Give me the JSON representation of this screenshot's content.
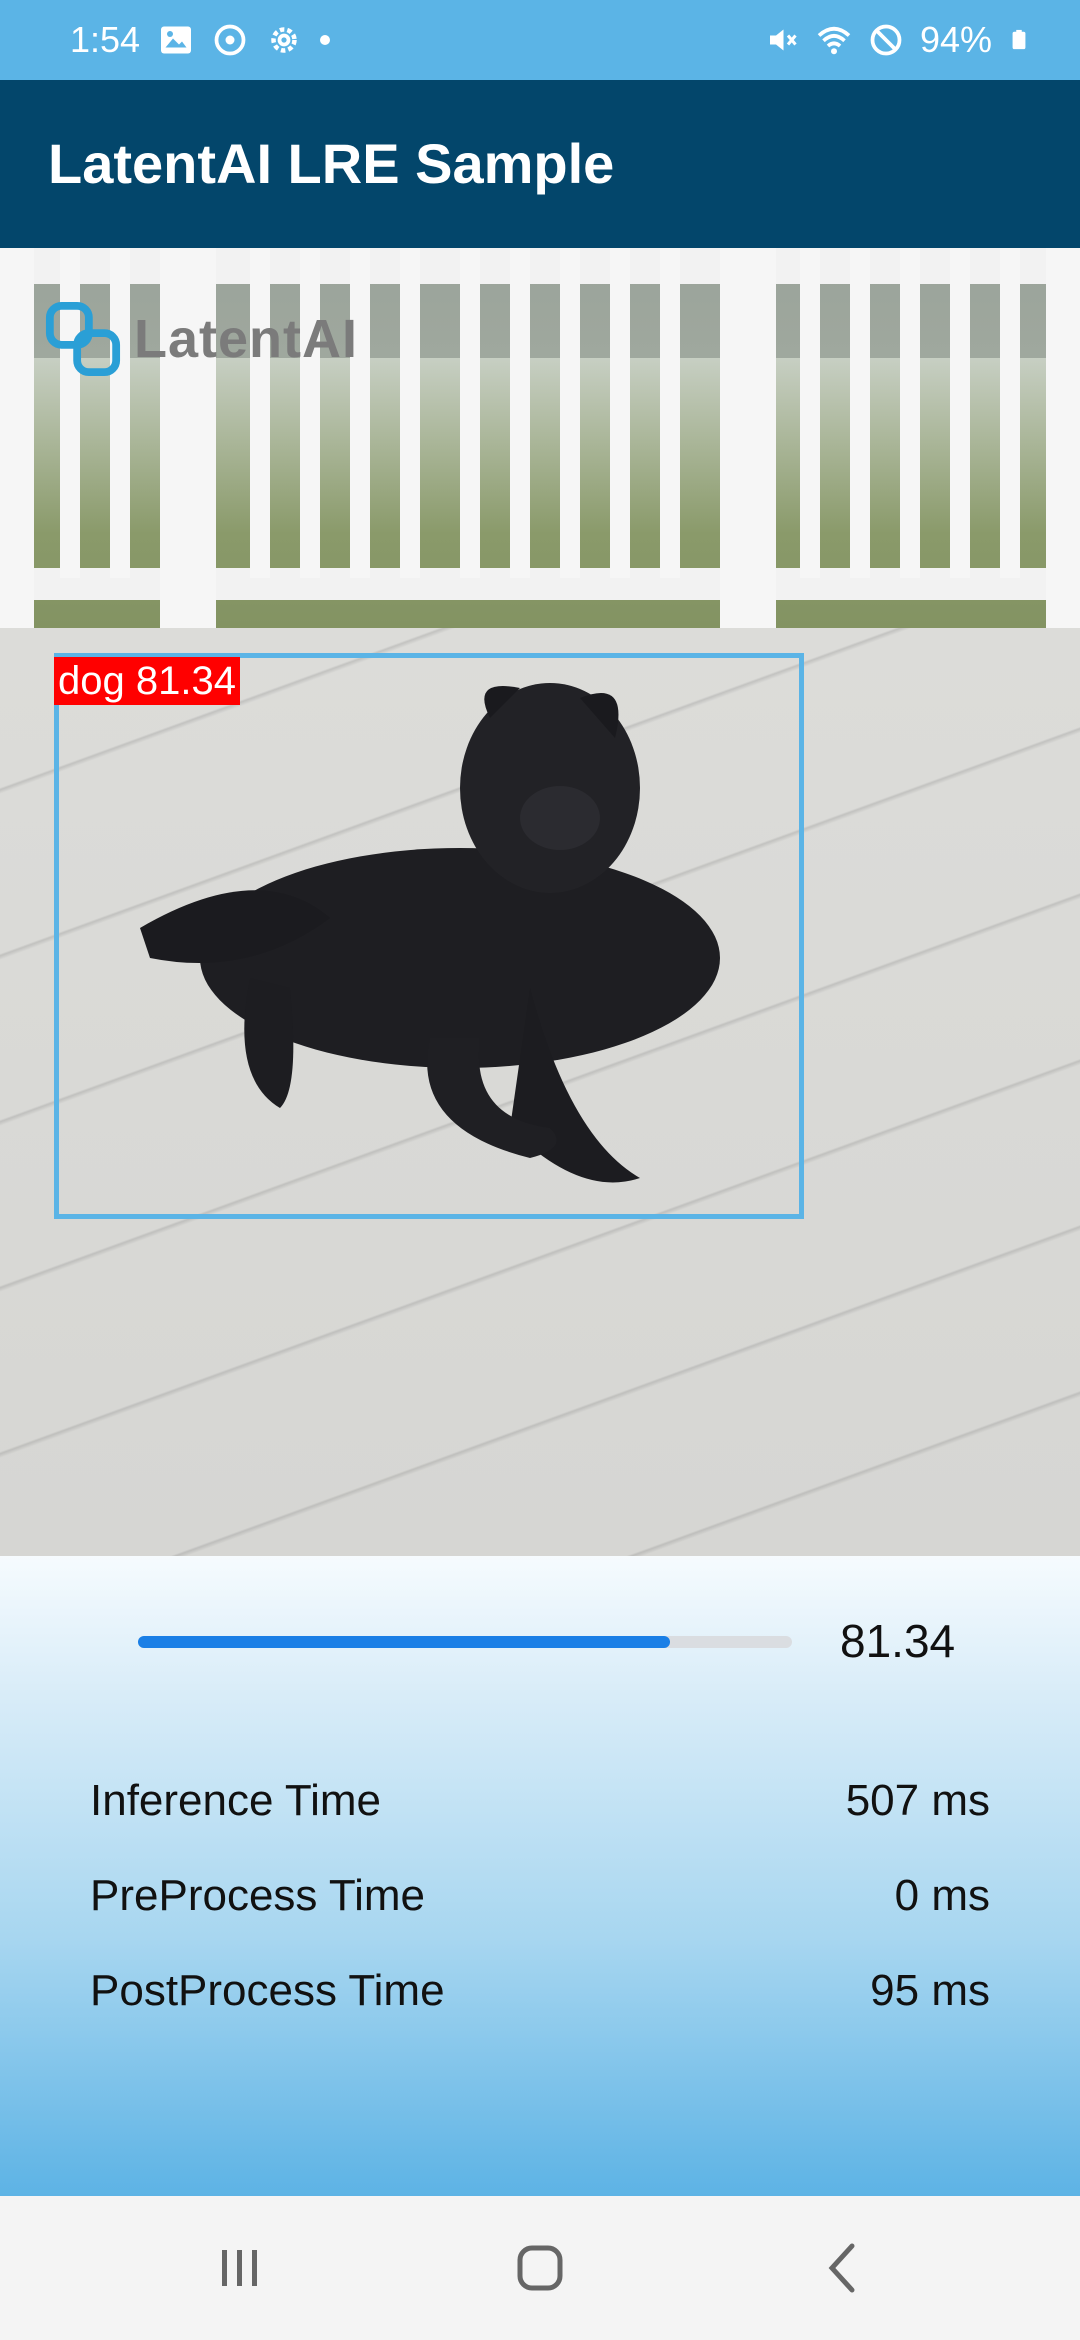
{
  "status_bar": {
    "time": "1:54",
    "battery": "94%",
    "left_icons": [
      "gallery-icon",
      "sync-icon",
      "settings-icon",
      "notification-dot"
    ],
    "right_icons": [
      "mute-icon",
      "wifi-icon",
      "do-not-disturb-icon",
      "battery-icon"
    ]
  },
  "app_bar": {
    "title": "LatentAI LRE Sample"
  },
  "image": {
    "logo_text": "LatentAI",
    "detection": {
      "label": "dog 81.34",
      "box_color": "#5bb4e6",
      "label_color": "#ff0000"
    }
  },
  "results": {
    "confidence_value": "81.34",
    "confidence_fraction": 0.8134,
    "metrics": [
      {
        "label": "Inference Time",
        "value": "507 ms"
      },
      {
        "label": "PreProcess Time",
        "value": "0 ms"
      },
      {
        "label": "PostProcess Time",
        "value": "95 ms"
      }
    ]
  },
  "colors": {
    "status_bar": "#5bb4e6",
    "app_bar": "#03466b",
    "progress_fill": "#1a7fe6"
  },
  "nav_bar": {
    "icons": [
      "recent-apps-icon",
      "home-icon",
      "back-icon"
    ]
  }
}
